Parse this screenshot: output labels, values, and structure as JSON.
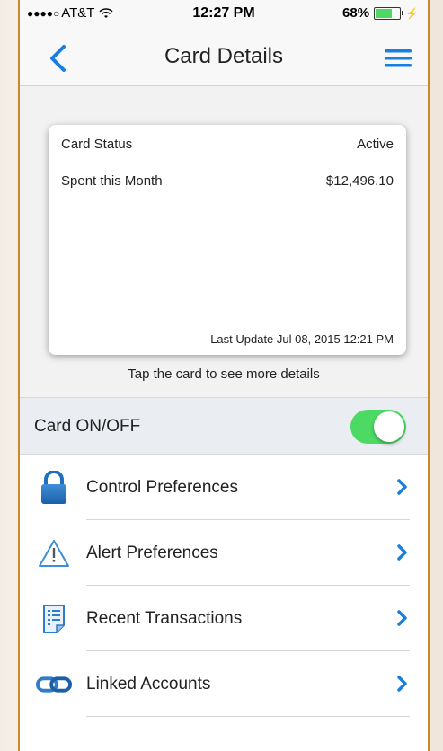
{
  "status_bar": {
    "carrier": "AT&T",
    "signal_dots": "●●●●○",
    "time": "12:27 PM",
    "battery_percent": "68%",
    "battery_level": 0.68
  },
  "nav": {
    "title": "Card Details",
    "back_icon": "chevron-left-icon",
    "menu_icon": "hamburger-menu-icon",
    "accent": "#1a7de0"
  },
  "card": {
    "status_label": "Card Status",
    "status_value": "Active",
    "spent_label": "Spent this Month",
    "spent_value": "$12,496.10",
    "last_update": "Last Update Jul 08, 2015 12:21 PM"
  },
  "tap_hint": "Tap the card to see more details",
  "card_toggle": {
    "label": "Card ON/OFF",
    "on": true,
    "on_color": "#4cd964"
  },
  "menu_items": [
    {
      "label": "Control Preferences",
      "icon": "lock-icon"
    },
    {
      "label": "Alert Preferences",
      "icon": "warning-icon"
    },
    {
      "label": "Recent Transactions",
      "icon": "receipt-icon"
    },
    {
      "label": "Linked Accounts",
      "icon": "link-icon"
    }
  ]
}
